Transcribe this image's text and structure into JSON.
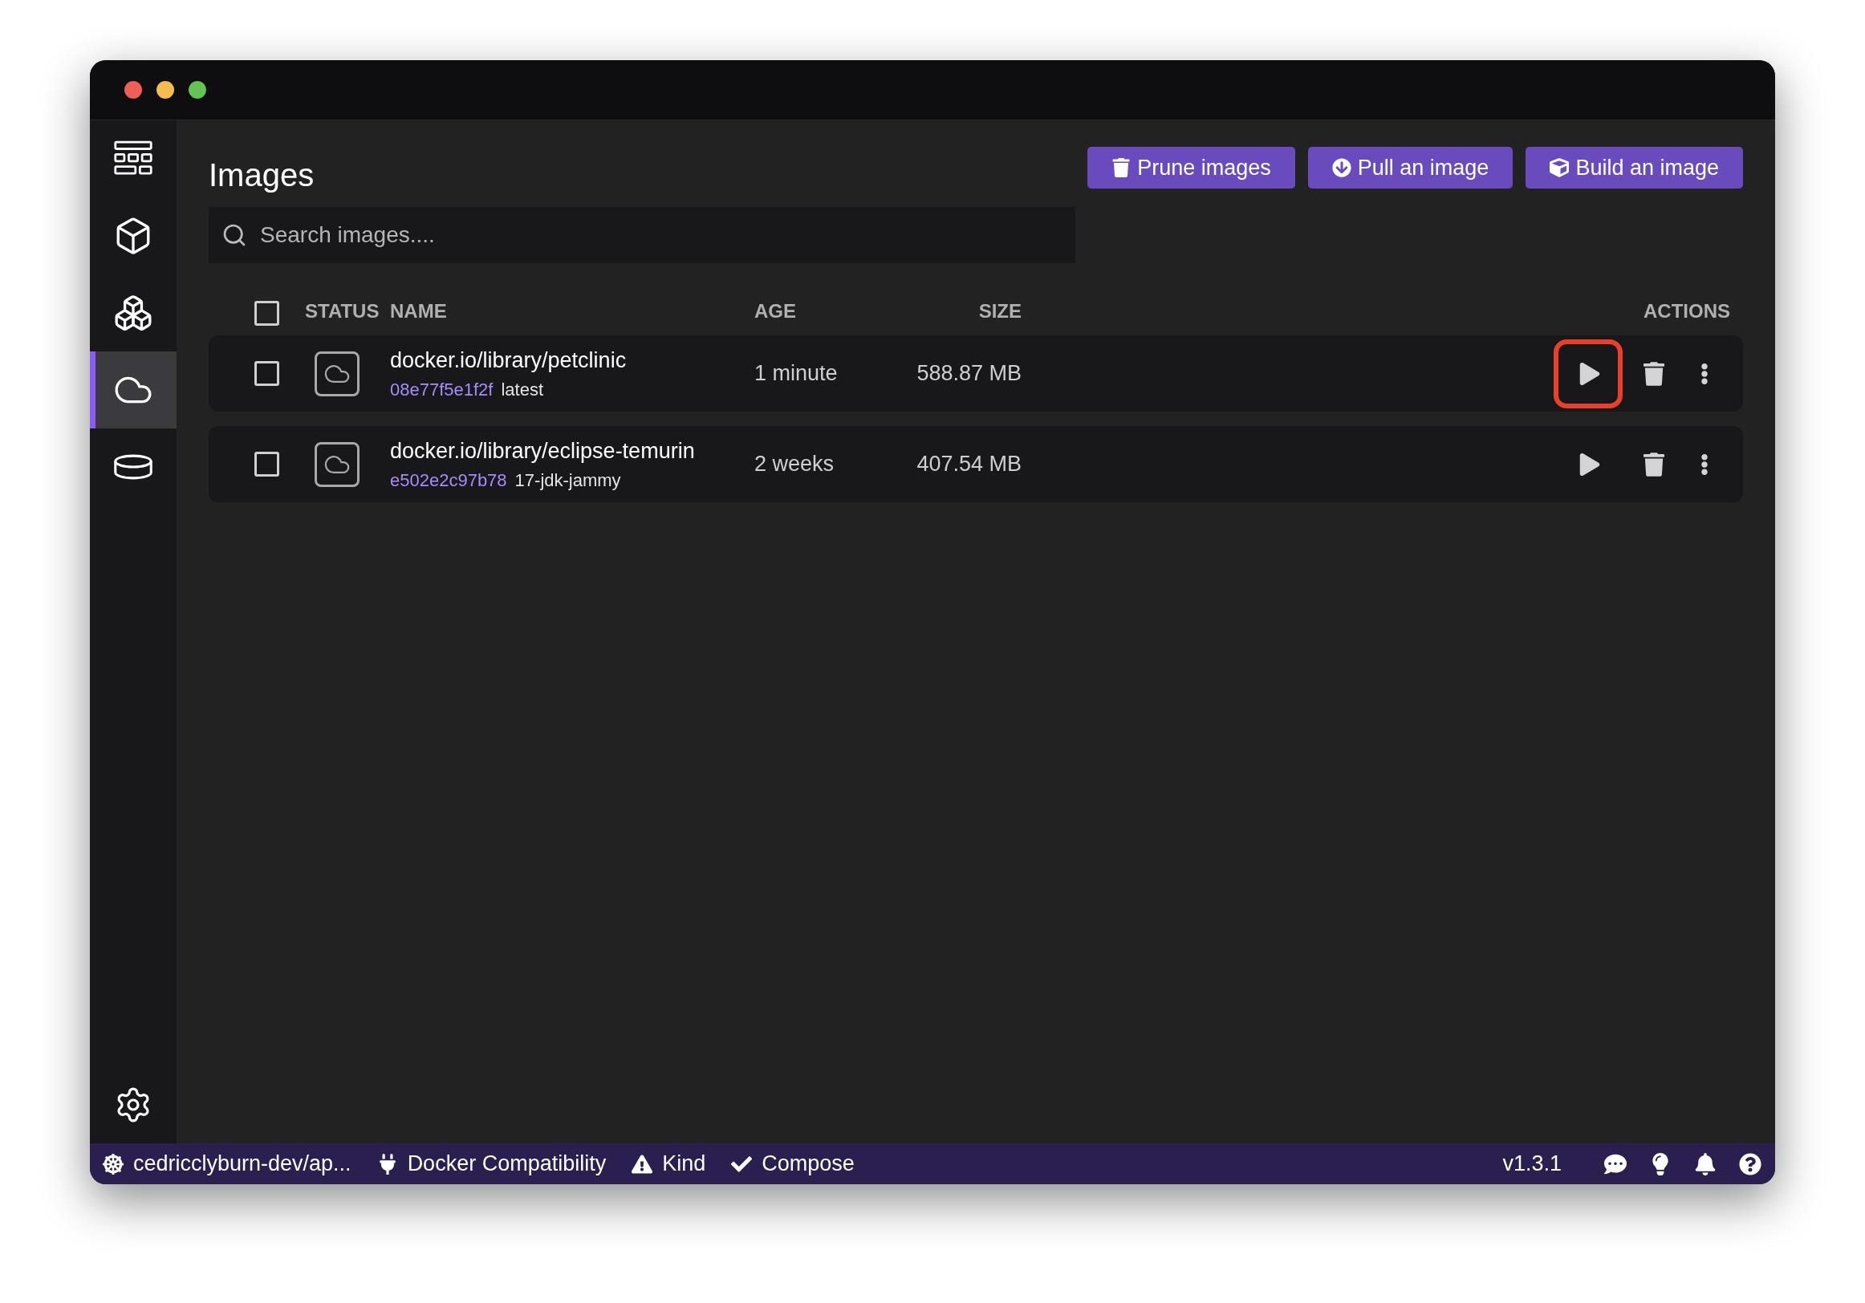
{
  "window": {
    "controls": [
      {
        "color": "#ee5f57"
      },
      {
        "color": "#f5bd4f"
      },
      {
        "color": "#61c454"
      }
    ]
  },
  "sidebar": {
    "items": [
      {
        "kind": "dashboard",
        "selected": false
      },
      {
        "kind": "containers",
        "selected": false
      },
      {
        "kind": "pods",
        "selected": false
      },
      {
        "kind": "images",
        "selected": true
      },
      {
        "kind": "volumes",
        "selected": false
      }
    ],
    "settings": {
      "selected": false
    }
  },
  "page": {
    "title": "Images",
    "buttons": [
      {
        "kind": "prune",
        "label": "Prune images"
      },
      {
        "kind": "pull",
        "label": "Pull an image"
      },
      {
        "kind": "build",
        "label": "Build an image"
      }
    ]
  },
  "search": {
    "placeholder": "Search images...."
  },
  "table": {
    "select_all": {
      "checked": false
    },
    "columns": [
      "STATUS",
      "NAME",
      "AGE",
      "SIZE",
      "ACTIONS"
    ],
    "rows": [
      {
        "checked": false,
        "name": "docker.io/library/petclinic",
        "id": "08e77f5e1f2f",
        "tag": "latest",
        "age": "1 minute",
        "size": "588.87 MB",
        "run_highlighted": true
      },
      {
        "checked": false,
        "name": "docker.io/library/eclipse-temurin",
        "id": "e502e2c97b78",
        "tag": "17-jdk-jammy",
        "age": "2 weeks",
        "size": "407.54 MB",
        "run_highlighted": false
      }
    ]
  },
  "status_bar": {
    "left": [
      {
        "kind": "kubernetes",
        "text": "cedricclyburn-dev/ap..."
      },
      {
        "kind": "plug",
        "text": "Docker Compatibility"
      },
      {
        "kind": "warning",
        "text": "Kind"
      },
      {
        "kind": "check",
        "text": "Compose"
      }
    ],
    "version": "v1.3.1",
    "right": [
      {
        "kind": "chat"
      },
      {
        "kind": "tip"
      },
      {
        "kind": "bell"
      },
      {
        "kind": "help"
      }
    ]
  }
}
